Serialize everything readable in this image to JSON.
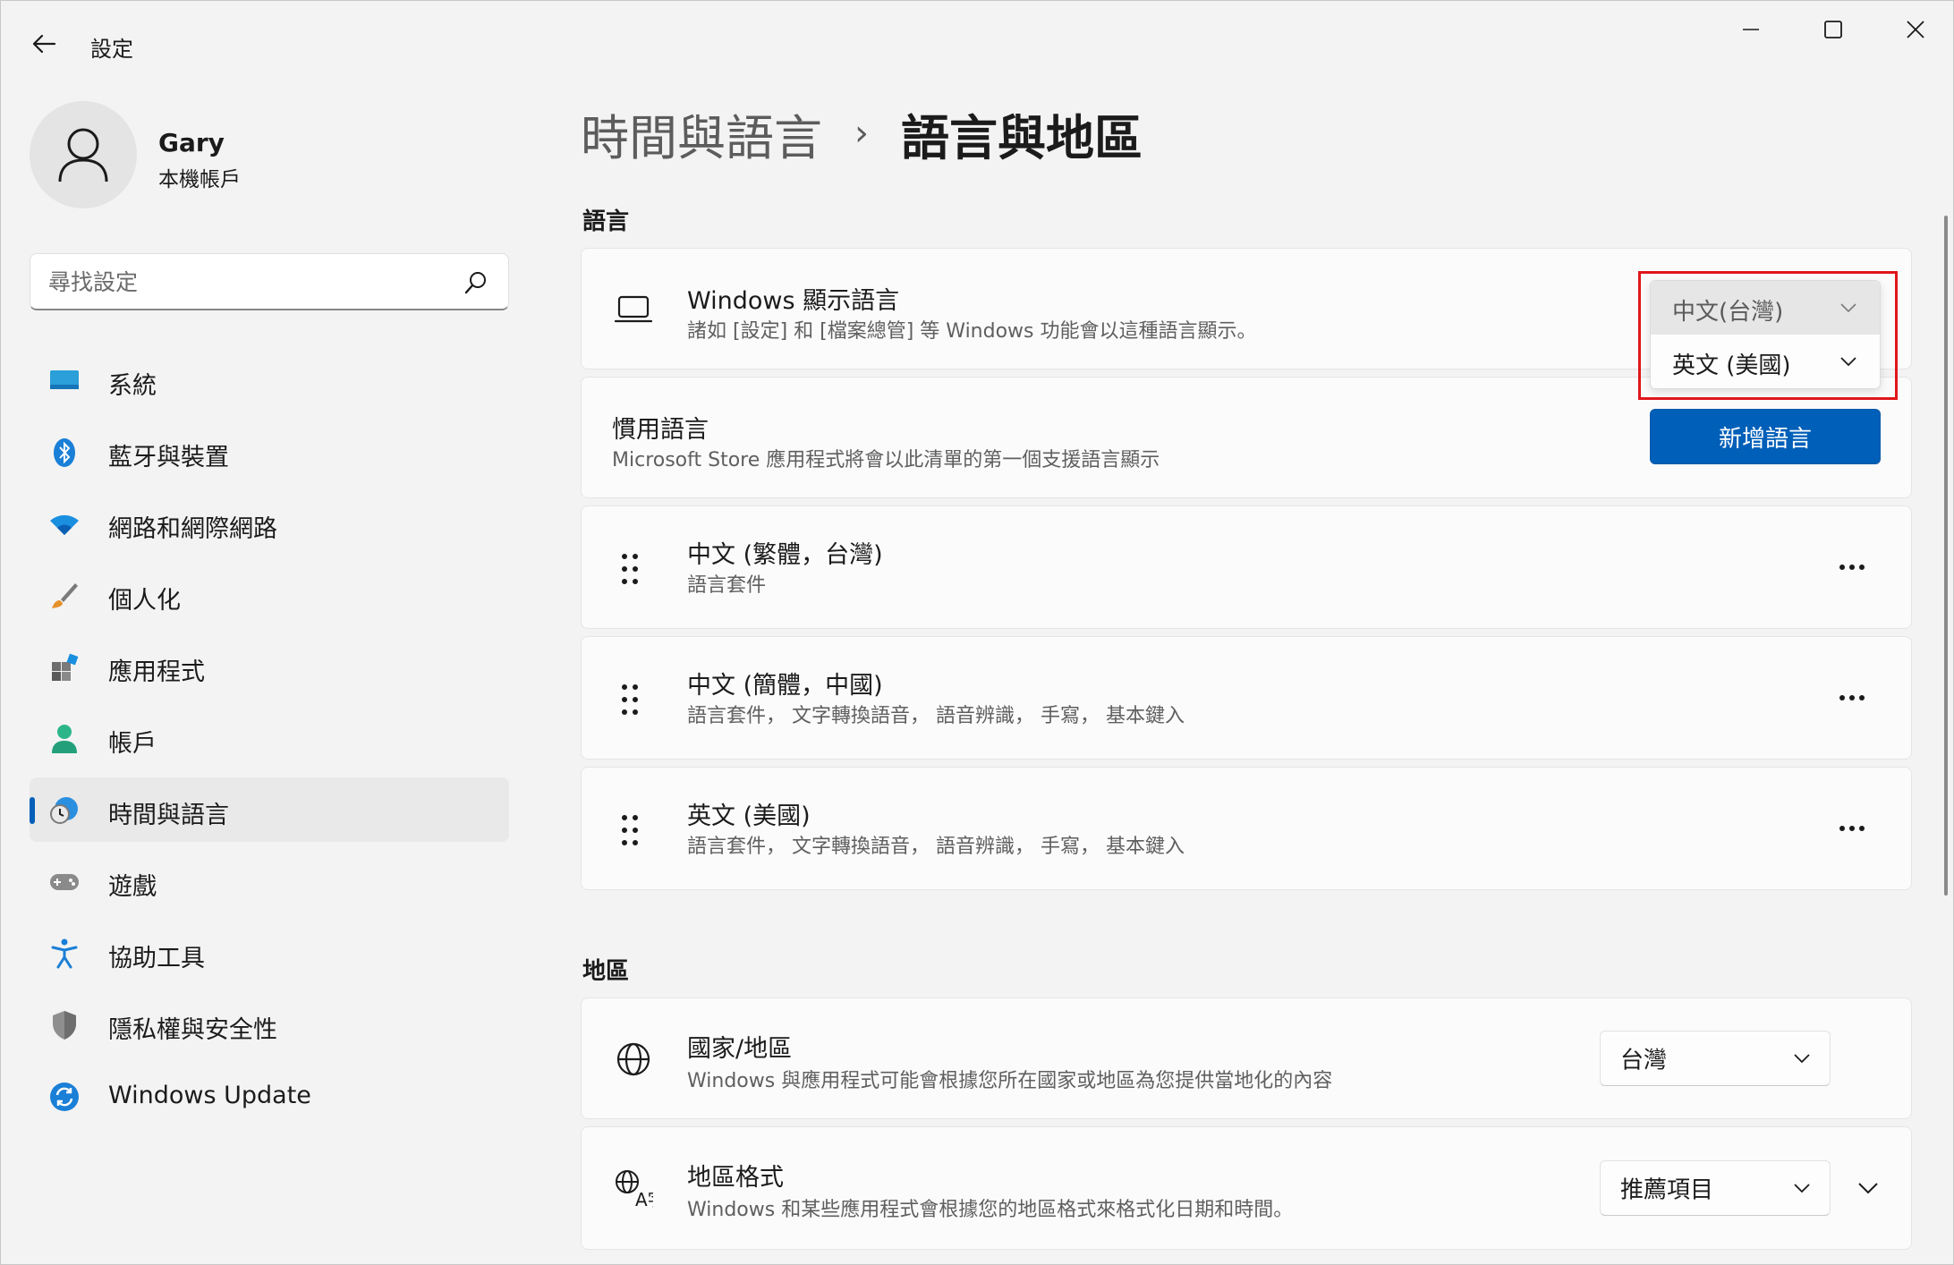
{
  "window": {
    "title": "設定"
  },
  "profile": {
    "name": "Gary",
    "subtitle": "本機帳戶"
  },
  "search": {
    "placeholder": "尋找設定"
  },
  "nav": {
    "items": [
      {
        "label": "系統",
        "icon": "system-icon"
      },
      {
        "label": "藍牙與裝置",
        "icon": "bluetooth-icon"
      },
      {
        "label": "網路和網際網路",
        "icon": "wifi-icon"
      },
      {
        "label": "個人化",
        "icon": "brush-icon"
      },
      {
        "label": "應用程式",
        "icon": "apps-icon"
      },
      {
        "label": "帳戶",
        "icon": "account-icon"
      },
      {
        "label": "時間與語言",
        "icon": "time-language-icon",
        "selected": true
      },
      {
        "label": "遊戲",
        "icon": "gamepad-icon"
      },
      {
        "label": "協助工具",
        "icon": "accessibility-icon"
      },
      {
        "label": "隱私權與安全性",
        "icon": "shield-icon"
      },
      {
        "label": "Windows Update",
        "icon": "update-icon"
      }
    ]
  },
  "breadcrumb": {
    "parent": "時間與語言",
    "separator": "›",
    "current": "語言與地區"
  },
  "language_section": {
    "title": "語言",
    "display_language": {
      "title": "Windows 顯示語言",
      "description": "諸如 [設定] 和 [檔案總管] 等 Windows 功能會以這種語言顯示。",
      "dropdown_options": [
        "中文(台灣)",
        "英文 (美國)"
      ]
    },
    "preferred": {
      "title": "慣用語言",
      "description": "Microsoft Store 應用程式將會以此清單的第一個支援語言顯示",
      "add_button": "新增語言"
    },
    "languages": [
      {
        "name": "中文 (繁體，台灣)",
        "features": "語言套件"
      },
      {
        "name": "中文 (簡體，中國)",
        "features": "語言套件， 文字轉換語音， 語音辨識， 手寫， 基本鍵入"
      },
      {
        "name": "英文 (美國)",
        "features": "語言套件， 文字轉換語音， 語音辨識， 手寫， 基本鍵入"
      }
    ]
  },
  "region_section": {
    "title": "地區",
    "country": {
      "title": "國家/地區",
      "description": "Windows 與應用程式可能會根據您所在國家或地區為您提供當地化的內容",
      "value": "台灣"
    },
    "format": {
      "title": "地區格式",
      "description": "Windows 和某些應用程式會根據您的地區格式來格式化日期和時間。",
      "value": "推薦項目"
    }
  },
  "colors": {
    "accent": "#005fb8",
    "highlight": "#e0161b",
    "background": "#f3f3f3",
    "card": "#fbfbfb"
  }
}
